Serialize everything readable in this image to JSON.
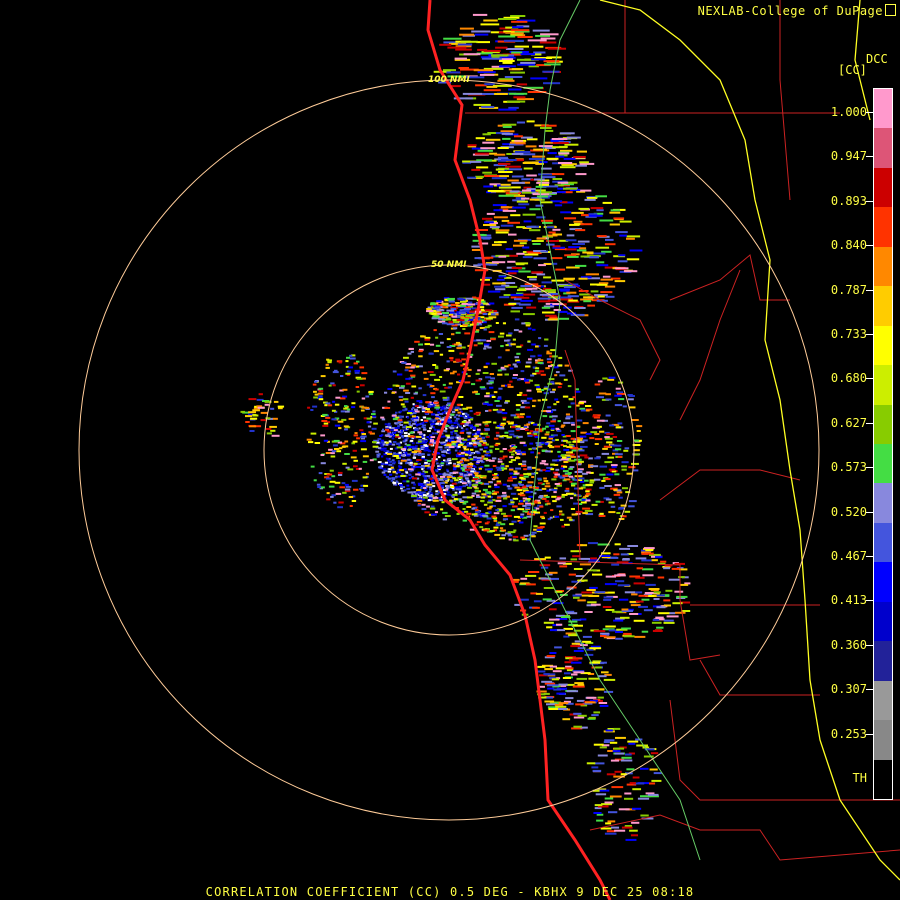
{
  "credit": "NEXLAB-College of DuPage",
  "credit_icon": "logo-icon",
  "product_code": "DCC",
  "product_abbr": "[CC]",
  "range_rings": [
    {
      "label": "50 NMI"
    },
    {
      "label": "100 NMI"
    }
  ],
  "legend": {
    "ticks": [
      "1.000",
      "0.947",
      "0.893",
      "0.840",
      "0.787",
      "0.733",
      "0.680",
      "0.627",
      "0.573",
      "0.520",
      "0.467",
      "0.413",
      "0.360",
      "0.307",
      "0.253",
      "TH"
    ],
    "colors": [
      "#ff99cc",
      "#dd5577",
      "#cc0000",
      "#ff3300",
      "#ff8800",
      "#ffcc00",
      "#ffff00",
      "#ccee00",
      "#88cc00",
      "#44dd44",
      "#8888dd",
      "#4455dd",
      "#0000ff",
      "#0000cc",
      "#222299",
      "#999999",
      "#888888",
      "#000000"
    ]
  },
  "colors": {
    "coast": "#ff2222",
    "county": "#cc2222",
    "state": "#ffff22",
    "river": "#66cc66",
    "ring": "#ffcc99",
    "text": "#ffff44"
  },
  "title": "CORRELATION COEFFICIENT (CC) 0.5 DEG - KBHX 9 DEC 25 08:18"
}
